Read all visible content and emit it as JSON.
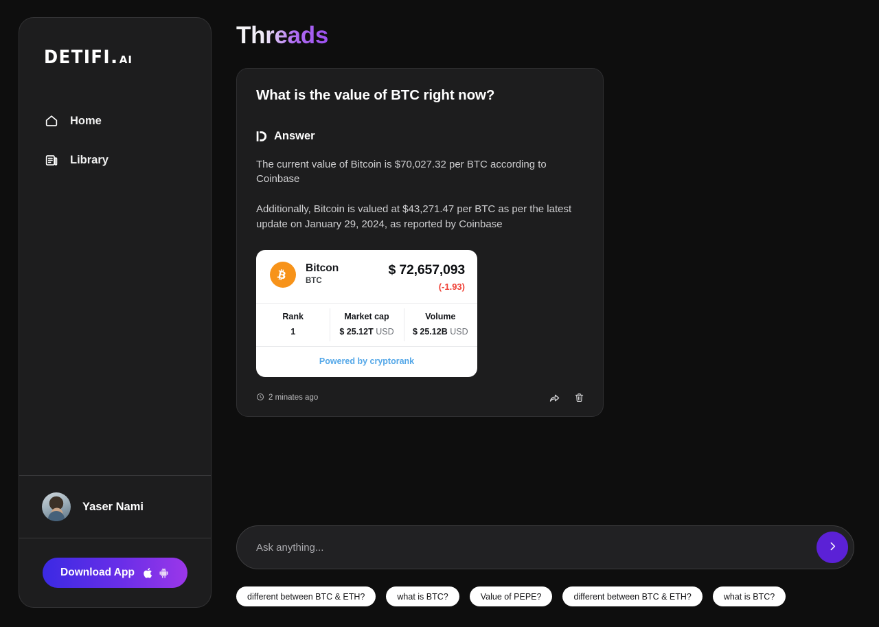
{
  "brand": {
    "logo_main": "DETIFI",
    "logo_dot": ".",
    "logo_ai": "AI"
  },
  "sidebar": {
    "items": [
      {
        "label": "Home",
        "icon": "home-icon"
      },
      {
        "label": "Library",
        "icon": "library-icon"
      }
    ],
    "profile": {
      "name": "Yaser Nami",
      "avatar": "user-avatar"
    },
    "download": {
      "label": "Download App",
      "icons": [
        "apple-icon",
        "android-icon"
      ],
      "gradient_from": "#3b2ae3",
      "gradient_to": "#9b37e9"
    }
  },
  "header": {
    "title": "Threads",
    "gradient_from": "#f7f7f7",
    "gradient_to": "#9b4ff0"
  },
  "thread": {
    "question": "What is the value of BTC right now?",
    "answer_logo": "D",
    "answer_label": "Answer",
    "paragraphs": [
      "The current value of Bitcoin is $70,027.32 per BTC according to Coinbase",
      "Additionally, Bitcoin is valued at $43,271.47 per BTC as per the latest update on January 29, 2024, as reported by Coinbase"
    ],
    "timestamp": "2 minates ago",
    "actions": [
      {
        "name": "share-icon"
      },
      {
        "name": "trash-icon"
      }
    ]
  },
  "crypto_card": {
    "coin_logo_symbol": "Ƀ",
    "coin_logo_color": "#f7931a",
    "coin_name": "Bitcon",
    "coin_symbol": "BTC",
    "price": "$ 72,657,093",
    "change": "(-1.93)",
    "change_color": "#ef4136",
    "stats": [
      {
        "label": "Rank",
        "value": "1",
        "unit": ""
      },
      {
        "label": "Market cap",
        "value": "$ 25.12T",
        "unit": "USD"
      },
      {
        "label": "Volume",
        "value": "$ 25.12B",
        "unit": "USD"
      }
    ],
    "footer_text": "Powered by cryptorank",
    "footer_color": "#53a7e8"
  },
  "ask": {
    "placeholder": "Ask anything...",
    "value": "",
    "send_icon": "chevron-right-icon",
    "send_color": "#5b21d6"
  },
  "suggestions": [
    "different between BTC & ETH?",
    "what is BTC?",
    "Value of PEPE?",
    "different between BTC & ETH?",
    "what is BTC?"
  ]
}
